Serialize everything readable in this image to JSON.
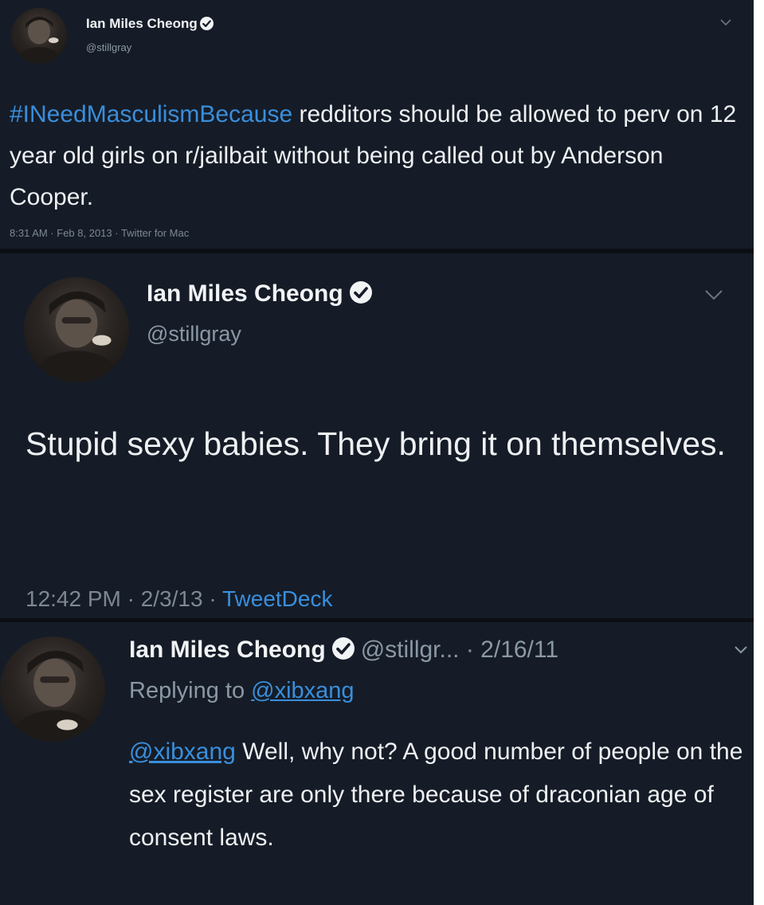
{
  "tweets": [
    {
      "display_name": "Ian Miles Cheong",
      "handle": "@stillgray",
      "hashtag": "#INeedMasculismBecause",
      "body": " redditors should be allowed to perv on 12 year old girls on r/jailbait without being called out by Anderson Cooper.",
      "meta": "8:31 AM · Feb 8, 2013 · Twitter for Mac",
      "verified_icon": "verified-badge-icon",
      "menu_icon": "chevron-down-icon"
    },
    {
      "display_name": "Ian Miles Cheong",
      "handle": "@stillgray",
      "body": "Stupid sexy babies. They bring it on themselves.",
      "meta_time": "12:42 PM · 2/3/13 · ",
      "meta_source": "TweetDeck",
      "verified_icon": "verified-badge-icon",
      "menu_icon": "chevron-down-icon"
    },
    {
      "display_name": "Ian Miles Cheong",
      "handle_date": "@stillgr... · 2/16/11",
      "replying_prefix": "Replying to ",
      "replying_to": "@xibxang",
      "mention": "@xibxang",
      "body": " Well, why not? A good number of people on the sex register are only there because of draconian age of consent laws.",
      "verified_icon": "verified-badge-icon",
      "menu_icon": "chevron-down-icon"
    }
  ],
  "colors": {
    "background": "#151c27",
    "link": "#3a8edb",
    "text": "#eef0f2",
    "muted": "#8b98a5"
  }
}
